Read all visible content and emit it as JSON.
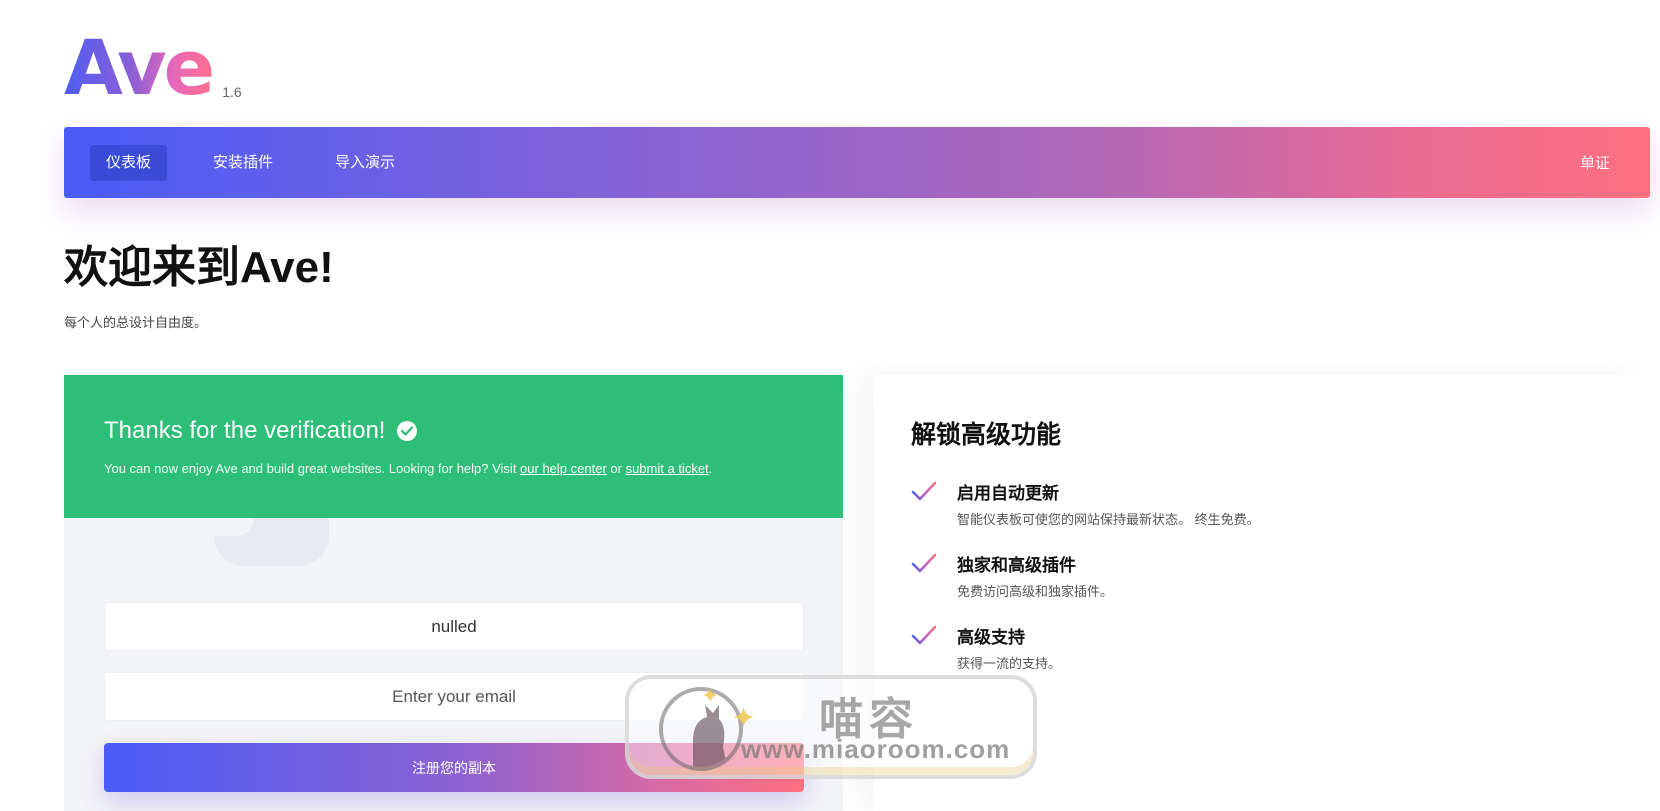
{
  "logo": {
    "text": "Ave",
    "version": "1.6"
  },
  "nav": {
    "items": [
      {
        "label": "仪表板",
        "active": true
      },
      {
        "label": "安装插件",
        "active": false
      },
      {
        "label": "导入演示",
        "active": false
      }
    ],
    "right_label": "单证"
  },
  "header": {
    "title": "欢迎来到Ave!",
    "subtitle": "每个人的总设计自由度。"
  },
  "verification": {
    "title": "Thanks for the verification!",
    "desc_prefix": "You can now enjoy Ave and build great websites. Looking for help? Visit ",
    "help_link": "our help center",
    "desc_or": " or ",
    "ticket_link": "submit a ticket",
    "desc_suffix": "."
  },
  "form": {
    "license_value": "nulled",
    "email_placeholder": "Enter your email",
    "register_label": "注册您的副本"
  },
  "premium": {
    "title": "解锁高级功能",
    "features": [
      {
        "title": "启用自动更新",
        "desc": "智能仪表板可使您的网站保持最新状态。 终生免费。"
      },
      {
        "title": "独家和高级插件",
        "desc": "免费访问高级和独家插件。"
      },
      {
        "title": "高级支持",
        "desc": "获得一流的支持。"
      }
    ]
  },
  "watermark": {
    "cn": "喵容",
    "url": "www.miaoroom.com"
  },
  "colors": {
    "nav_gradient_start": "#4a5cf7",
    "nav_gradient_end": "#ff6f80",
    "success_green": "#2dbf77",
    "card_bg": "#f3f4f7"
  },
  "icons": {
    "verify": "check-circle-icon",
    "feature": "check-icon"
  }
}
